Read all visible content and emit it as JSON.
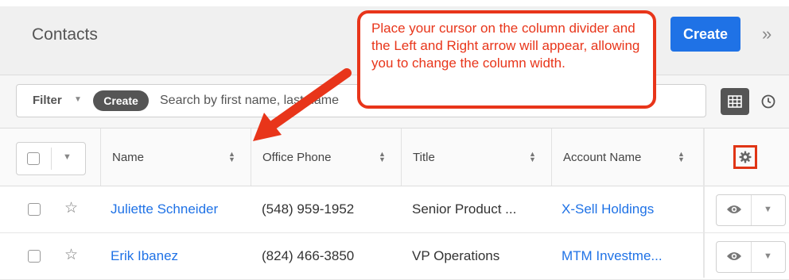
{
  "header": {
    "title": "Contacts",
    "create_label": "Create",
    "expand_icon": "chevron-double-right-icon"
  },
  "filter": {
    "label": "Filter",
    "create_label": "Create",
    "search_placeholder": "Search by first name, last name",
    "list_view_icon": "grid-icon",
    "activity_view_icon": "clock-icon"
  },
  "columns": [
    {
      "label": "Name"
    },
    {
      "label": "Office Phone"
    },
    {
      "label": "Title"
    },
    {
      "label": "Account Name"
    }
  ],
  "rows": [
    {
      "name": "Juliette Schneider",
      "phone": "(548) 959-1952",
      "title": "Senior Product ...",
      "account": "X-Sell Holdings"
    },
    {
      "name": "Erik Ibanez",
      "phone": "(824) 466-3850",
      "title": "VP Operations",
      "account": "MTM Investme..."
    }
  ],
  "callout": {
    "text": "Place your cursor on the column divider and the Left and Right arrow will appear, allowing you to change the column width."
  },
  "colors": {
    "brand_blue": "#1f72e6",
    "annotation_red": "#e8351a"
  }
}
